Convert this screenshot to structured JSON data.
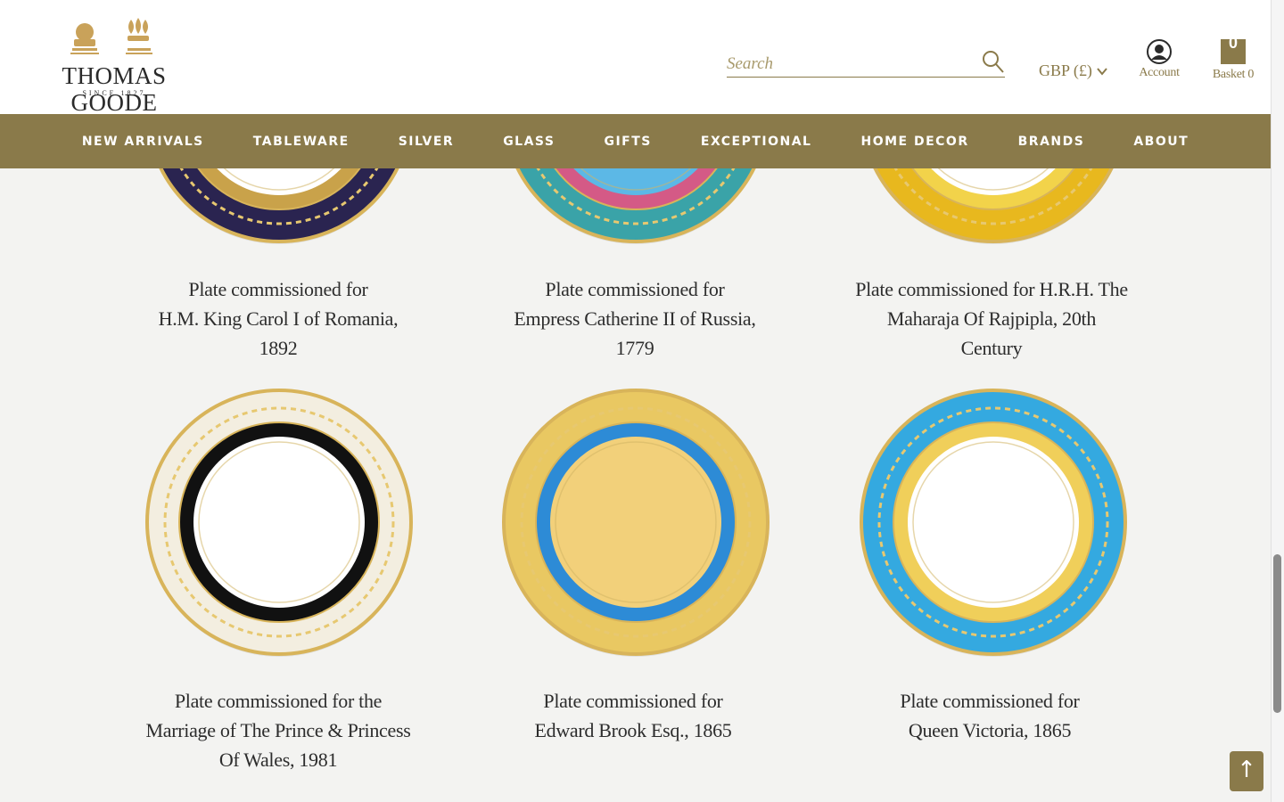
{
  "brand": {
    "name": "THOMAS GOODE",
    "since": "SINCE 1827"
  },
  "search": {
    "placeholder": "Search"
  },
  "currency": {
    "label": "GBP (£)"
  },
  "account": {
    "label": "Account"
  },
  "basket": {
    "label": "Basket 0",
    "count": "0"
  },
  "nav": [
    "NEW ARRIVALS",
    "TABLEWARE",
    "SILVER",
    "GLASS",
    "GIFTS",
    "EXCEPTIONAL",
    "HOME DECOR",
    "BRANDS",
    "ABOUT"
  ],
  "products": [
    {
      "lines": [
        "Plate commissioned for",
        "H.M. King Carol I of Romania,",
        "1892"
      ],
      "rim": "#2a2450",
      "band": "#c9a24a",
      "center": "#ffffff"
    },
    {
      "lines": [
        "Plate commissioned for",
        "Empress Catherine II of Russia,",
        "1779"
      ],
      "rim": "#3aa3a8",
      "band": "#d45a86",
      "center": "#5cb8e6"
    },
    {
      "lines": [
        "Plate commissioned for H.R.H. The",
        "Maharaja Of Rajpipla, 20th",
        "Century"
      ],
      "rim": "#e8b81e",
      "band": "#f2d34a",
      "center": "#ffffff"
    },
    {
      "lines": [
        "Plate commissioned for the",
        "Marriage of The Prince & Princess",
        "Of Wales, 1981"
      ],
      "rim": "#f3eee0",
      "band": "#111111",
      "center": "#ffffff"
    },
    {
      "lines": [
        "Plate commissioned for",
        "Edward Brook Esq., 1865"
      ],
      "rim": "#e9c862",
      "band": "#2d8bd6",
      "center": "#f2d07a"
    },
    {
      "lines": [
        "Plate commissioned for",
        "Queen Victoria, 1865"
      ],
      "rim": "#34a9e0",
      "band": "#f0cf5a",
      "center": "#ffffff"
    }
  ],
  "back_to_top": "↑",
  "colors": {
    "brand_gold": "#8a7a4a",
    "page_bg": "#f3f3f1"
  }
}
